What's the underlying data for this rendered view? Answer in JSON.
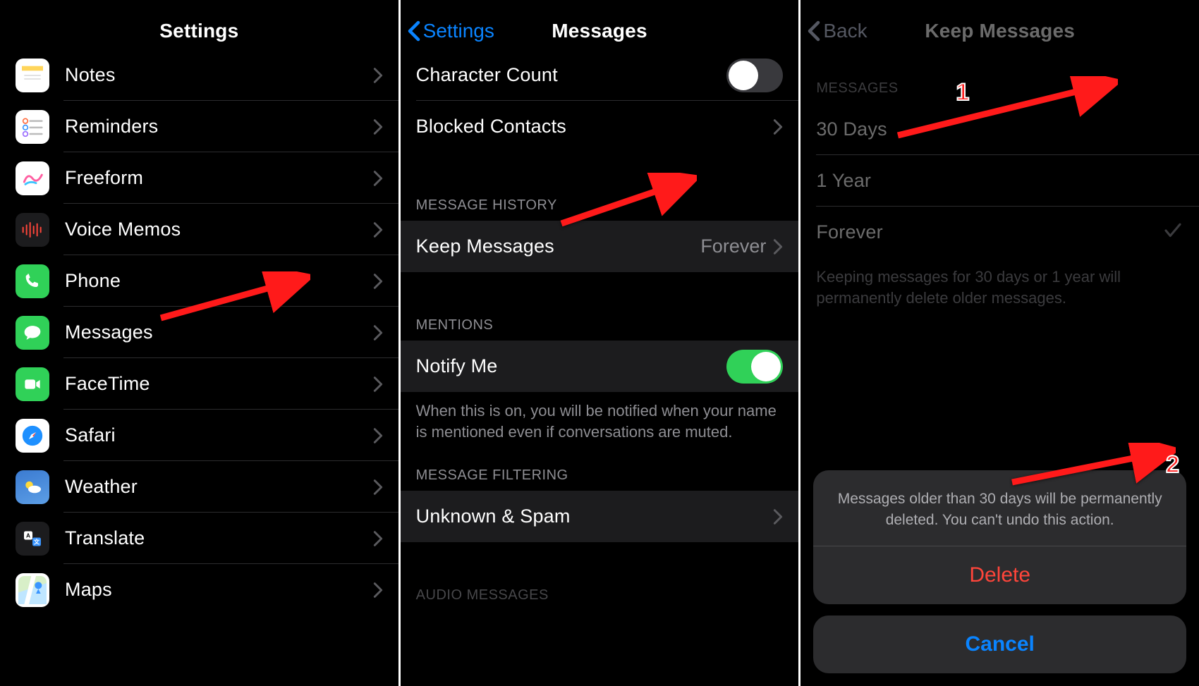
{
  "screen1": {
    "title": "Settings",
    "items": [
      {
        "label": "Notes"
      },
      {
        "label": "Reminders"
      },
      {
        "label": "Freeform"
      },
      {
        "label": "Voice Memos"
      },
      {
        "label": "Phone"
      },
      {
        "label": "Messages"
      },
      {
        "label": "FaceTime"
      },
      {
        "label": "Safari"
      },
      {
        "label": "Weather"
      },
      {
        "label": "Translate"
      },
      {
        "label": "Maps"
      }
    ]
  },
  "screen2": {
    "back": "Settings",
    "title": "Messages",
    "character_count_label": "Character Count",
    "blocked_label": "Blocked Contacts",
    "history_header": "MESSAGE HISTORY",
    "keep_label": "Keep Messages",
    "keep_value": "Forever",
    "mentions_header": "MENTIONS",
    "notify_label": "Notify Me",
    "notify_footer": "When this is on, you will be notified when your name is mentioned even if conversations are muted.",
    "filtering_header": "MESSAGE FILTERING",
    "unknown_label": "Unknown & Spam",
    "audio_header": "AUDIO MESSAGES"
  },
  "screen3": {
    "back": "Back",
    "title": "Keep Messages",
    "section_header": "MESSAGES",
    "options": [
      {
        "label": "30 Days"
      },
      {
        "label": "1 Year"
      },
      {
        "label": "Forever"
      }
    ],
    "footer": "Keeping messages for 30 days or 1 year will permanently delete older messages.",
    "alert_text": "Messages older than 30 days will be permanently deleted. You can't undo this action.",
    "alert_delete": "Delete",
    "alert_cancel": "Cancel"
  },
  "annotations": {
    "num1": "1",
    "num2": "2"
  }
}
